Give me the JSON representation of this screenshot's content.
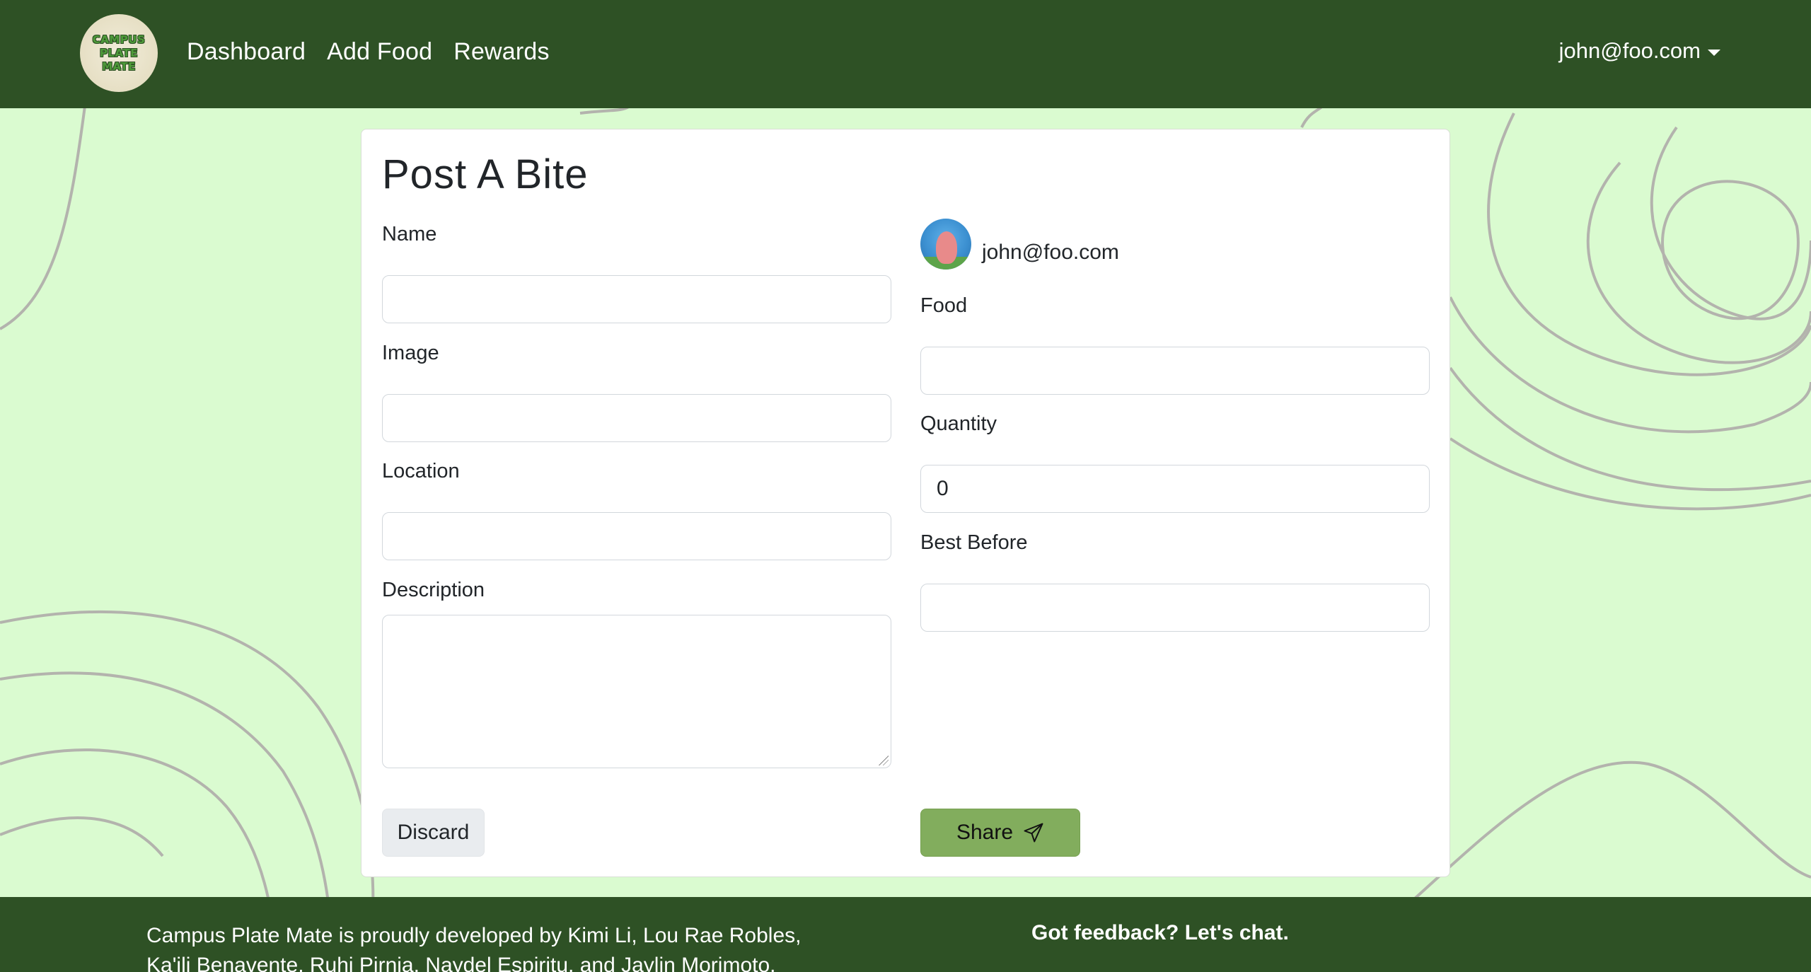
{
  "brand": {
    "logo_lines": [
      "CAMPUS",
      "PLATE",
      "MATE"
    ]
  },
  "nav": {
    "links": [
      "Dashboard",
      "Add Food",
      "Rewards"
    ],
    "user": "john@foo.com"
  },
  "form": {
    "title": "Post A Bite",
    "owner": "john@foo.com",
    "fields": {
      "name": {
        "label": "Name",
        "value": ""
      },
      "image": {
        "label": "Image",
        "value": ""
      },
      "location": {
        "label": "Location",
        "value": ""
      },
      "description": {
        "label": "Description",
        "value": ""
      },
      "food": {
        "label": "Food",
        "value": ""
      },
      "quantity": {
        "label": "Quantity",
        "value": "0"
      },
      "best_before": {
        "label": "Best Before",
        "value": ""
      }
    },
    "buttons": {
      "discard": "Discard",
      "share": "Share"
    }
  },
  "footer": {
    "credits_line1": "Campus Plate Mate is proudly developed by Kimi Li, Lou Rae Robles,",
    "credits_line2": "Ka'ili Benavente, Ruhi Pirnia, Naydel Espiritu, and Jaylin Morimoto.",
    "feedback": "Got feedback? Let's chat."
  },
  "colors": {
    "navbar": "#2e5125",
    "background": "#dafbd0",
    "share_button": "#82ad5d",
    "contour_lines": "#b3b3ad"
  }
}
